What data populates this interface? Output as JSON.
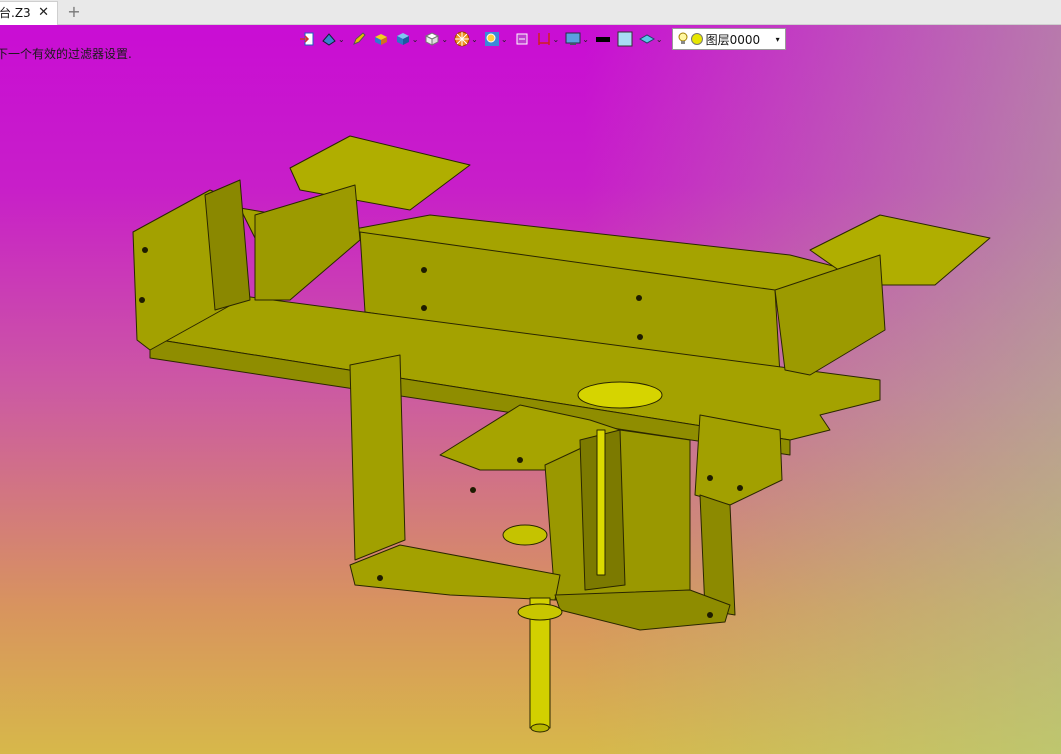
{
  "tab": {
    "title": "台.Z3",
    "close_glyph": "✕",
    "add_glyph": "+"
  },
  "status_message": "下一个有效的过滤器设置.",
  "toolbar": {
    "icons": [
      "exit-sketch-icon",
      "view-orient-icon",
      "pencil-icon",
      "shade-icon",
      "box-render-icon",
      "cube-icon",
      "filter-wheel-icon",
      "zoom-icon",
      "clip-icon",
      "dimension-icon",
      "display-icon",
      "line-color-swatch",
      "fill-color-swatch",
      "layer-style-icon"
    ],
    "layer": {
      "label": "图层0000",
      "bulb": "lightbulb-icon"
    }
  },
  "colors": {
    "model_face": "#a3a200",
    "model_dark": "#7a7700",
    "model_light": "#d4d200",
    "model_edge": "#2a2600"
  }
}
